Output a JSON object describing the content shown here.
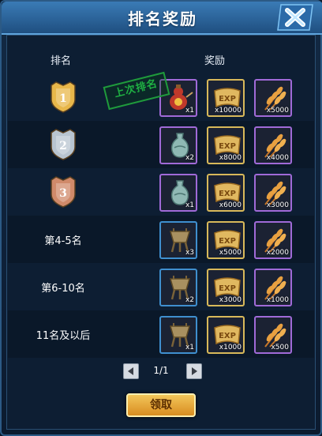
{
  "window": {
    "title": "排名奖励",
    "close_icon": "close-x-icon"
  },
  "headers": {
    "rank": "排名",
    "reward": "奖励"
  },
  "stamp": {
    "text": "上次排名"
  },
  "rows": [
    {
      "rank_label": "",
      "medal": "gold-medal-1",
      "medal_number": "1",
      "items": [
        {
          "icon": "gourd-icon",
          "qty": "x1",
          "border": "purple"
        },
        {
          "icon": "exp-scroll-icon",
          "qty": "x10000",
          "border": "gold"
        },
        {
          "icon": "wheat-icon",
          "qty": "x5000",
          "border": "purple"
        }
      ]
    },
    {
      "rank_label": "",
      "medal": "silver-medal-2",
      "medal_number": "2",
      "items": [
        {
          "icon": "vase-icon",
          "qty": "x2",
          "border": "purple"
        },
        {
          "icon": "exp-scroll-icon",
          "qty": "x8000",
          "border": "gold"
        },
        {
          "icon": "wheat-icon",
          "qty": "x4000",
          "border": "purple"
        }
      ]
    },
    {
      "rank_label": "",
      "medal": "bronze-medal-3",
      "medal_number": "3",
      "items": [
        {
          "icon": "vase-icon",
          "qty": "x1",
          "border": "purple"
        },
        {
          "icon": "exp-scroll-icon",
          "qty": "x6000",
          "border": "gold"
        },
        {
          "icon": "wheat-icon",
          "qty": "x3000",
          "border": "purple"
        }
      ]
    },
    {
      "rank_label": "第4-5名",
      "items": [
        {
          "icon": "bronze-vessel-icon",
          "qty": "x3",
          "border": "blue"
        },
        {
          "icon": "exp-scroll-icon",
          "qty": "x5000",
          "border": "gold"
        },
        {
          "icon": "wheat-icon",
          "qty": "x2000",
          "border": "purple"
        }
      ]
    },
    {
      "rank_label": "第6-10名",
      "items": [
        {
          "icon": "bronze-vessel-icon",
          "qty": "x2",
          "border": "blue"
        },
        {
          "icon": "exp-scroll-icon",
          "qty": "x3000",
          "border": "gold"
        },
        {
          "icon": "wheat-icon",
          "qty": "x1000",
          "border": "purple"
        }
      ]
    },
    {
      "rank_label": "11名及以后",
      "items": [
        {
          "icon": "bronze-vessel-icon",
          "qty": "x1",
          "border": "blue"
        },
        {
          "icon": "exp-scroll-icon",
          "qty": "x1000",
          "border": "gold"
        },
        {
          "icon": "wheat-icon",
          "qty": "x500",
          "border": "purple"
        }
      ]
    }
  ],
  "pager": {
    "text": "1/1",
    "prev_icon": "arrow-left-icon",
    "next_icon": "arrow-right-icon"
  },
  "claim_button": {
    "label": "领取"
  },
  "colors": {
    "medal_gold": "#e8b74a",
    "medal_silver": "#b8c4d0",
    "medal_bronze": "#d08a6a",
    "stamp_green": "#1fb043"
  }
}
